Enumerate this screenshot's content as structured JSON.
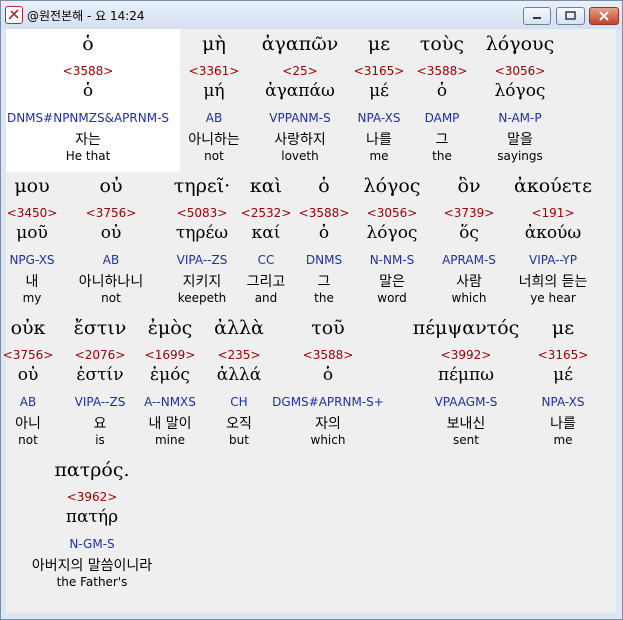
{
  "window": {
    "title": "@원전본해 - 요 14:24"
  },
  "rows": [
    {
      "words": [
        {
          "greek": "ὁ",
          "strong": "<3588>",
          "lemma": "ὁ",
          "parsing": "DNMS#NPNMZS&APRNM-S",
          "korean": "자는",
          "english": "He that"
        },
        {
          "greek": "μὴ",
          "strong": "<3361>",
          "lemma": "μή",
          "parsing": "AB",
          "korean": "아니하는",
          "english": "not"
        },
        {
          "greek": "ἀγαπῶν",
          "strong": "<25>",
          "lemma": "ἀγαπάω",
          "parsing": "VPPANM-S",
          "korean": "사랑하지",
          "english": "loveth"
        },
        {
          "greek": "με",
          "strong": "<3165>",
          "lemma": "μέ",
          "parsing": "NPA-XS",
          "korean": "나를",
          "english": "me"
        },
        {
          "greek": "τοὺς",
          "strong": "<3588>",
          "lemma": "ὁ",
          "parsing": "DAMP",
          "korean": "그",
          "english": "the"
        },
        {
          "greek": "λόγους",
          "strong": "<3056>",
          "lemma": "λόγος",
          "parsing": "N-AM-P",
          "korean": "말을",
          "english": "sayings"
        }
      ]
    },
    {
      "words": [
        {
          "greek": "μου",
          "strong": "<3450>",
          "lemma": "μοῦ",
          "parsing": "NPG-XS",
          "korean": "내",
          "english": "my"
        },
        {
          "greek": "οὐ",
          "strong": "<3756>",
          "lemma": "οὐ",
          "parsing": "AB",
          "korean": "아니하나니",
          "english": "not"
        },
        {
          "greek": "τηρεῖ·",
          "strong": "<5083>",
          "lemma": "τηρέω",
          "parsing": "VIPA--ZS",
          "korean": "지키지",
          "english": "keepeth"
        },
        {
          "greek": "καὶ",
          "strong": "<2532>",
          "lemma": "καί",
          "parsing": "CC",
          "korean": "그리고",
          "english": "and"
        },
        {
          "greek": "ὁ",
          "strong": "<3588>",
          "lemma": "ὁ",
          "parsing": "DNMS",
          "korean": "그",
          "english": "the"
        },
        {
          "greek": "λόγος",
          "strong": "<3056>",
          "lemma": "λόγος",
          "parsing": "N-NM-S",
          "korean": "말은",
          "english": "word"
        },
        {
          "greek": "ὃν",
          "strong": "<3739>",
          "lemma": "ὅς",
          "parsing": "APRAM-S",
          "korean": "사람",
          "english": "which"
        },
        {
          "greek": "ἀκούετε",
          "strong": "<191>",
          "lemma": "ἀκούω",
          "parsing": "VIPA--YP",
          "korean": "너희의 듣는",
          "english": "ye hear"
        }
      ]
    },
    {
      "words": [
        {
          "greek": "οὐκ",
          "strong": "<3756>",
          "lemma": "οὐ",
          "parsing": "AB",
          "korean": "아니",
          "english": "not"
        },
        {
          "greek": "ἔστιν",
          "strong": "<2076>",
          "lemma": "ἐστίν",
          "parsing": "VIPA--ZS",
          "korean": "요",
          "english": "is"
        },
        {
          "greek": "ἐμὸς",
          "strong": "<1699>",
          "lemma": "ἐμός",
          "parsing": "A--NMXS",
          "korean": "내 말이",
          "english": "mine"
        },
        {
          "greek": "ἀλλὰ",
          "strong": "<235>",
          "lemma": "ἀλλά",
          "parsing": "CH",
          "korean": "오직",
          "english": "but"
        },
        {
          "greek": "τοῦ",
          "strong": "<3588>",
          "lemma": "ὁ",
          "parsing": "DGMS#APRNM-S+",
          "korean": "자의",
          "english": "which"
        },
        {
          "greek": "πέμψαντός",
          "strong": "<3992>",
          "lemma": "πέμπω",
          "parsing": "VPAAGM-S",
          "korean": "보내신",
          "english": "sent"
        },
        {
          "greek": "με",
          "strong": "<3165>",
          "lemma": "μέ",
          "parsing": "NPA-XS",
          "korean": "나를",
          "english": "me"
        }
      ]
    },
    {
      "words": [
        {
          "greek": "πατρός.",
          "strong": "<3962>",
          "lemma": "πατήρ",
          "parsing": "N-GM-S",
          "korean": "아버지의 말씀이니라",
          "english": "the Father's"
        }
      ]
    }
  ]
}
